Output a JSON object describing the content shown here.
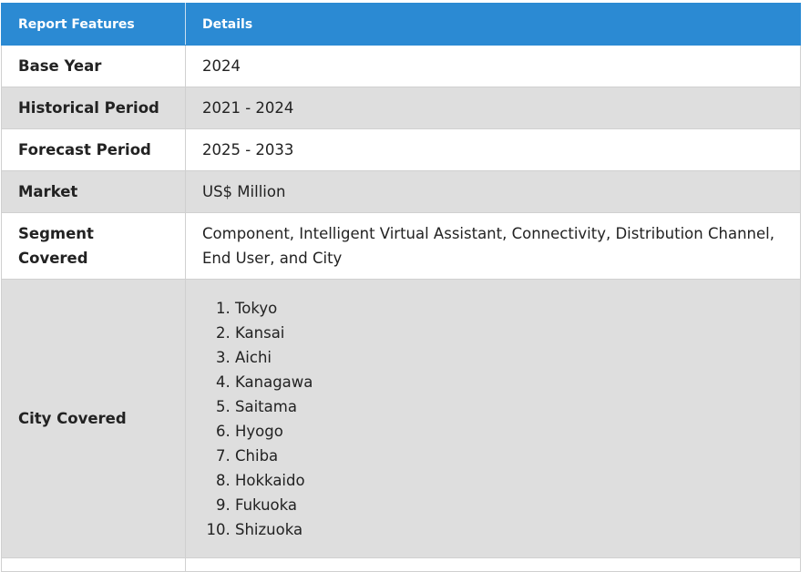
{
  "table": {
    "header": {
      "feature_label": "Report Features",
      "details_label": "Details"
    },
    "rows": [
      {
        "feature": "Base Year",
        "details": "2024"
      },
      {
        "feature": "Historical Period",
        "details": "2021 - 2024"
      },
      {
        "feature": "Forecast Period",
        "details": "2025 - 2033"
      },
      {
        "feature": "Market",
        "details": "US$ Million"
      },
      {
        "feature": "Segment Covered",
        "details": "Component, Intelligent Virtual Assistant, Connectivity, Distribution Channel, End User, and City"
      }
    ],
    "city_row": {
      "feature": "City Covered",
      "cities": [
        "Tokyo",
        "Kansai",
        "Aichi",
        "Kanagawa",
        "Saitama",
        "Hyogo",
        "Chiba",
        "Hokkaido",
        "Fukuoka",
        "Shizuoka"
      ]
    }
  }
}
